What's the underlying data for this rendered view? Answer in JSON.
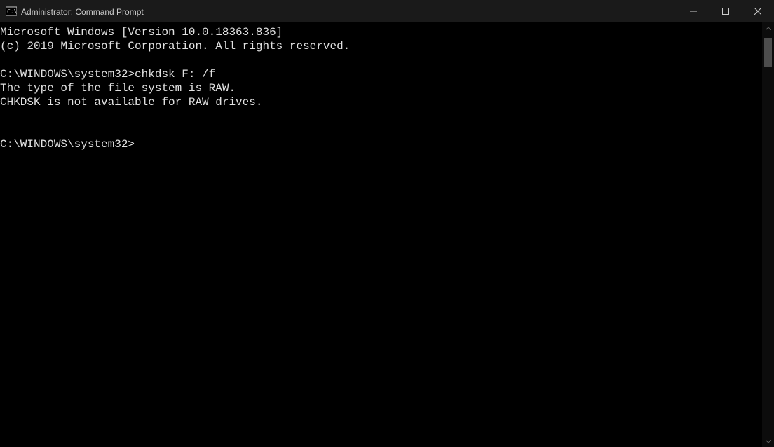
{
  "window": {
    "title": "Administrator: Command Prompt"
  },
  "terminal": {
    "lines": [
      "Microsoft Windows [Version 10.0.18363.836]",
      "(c) 2019 Microsoft Corporation. All rights reserved.",
      "",
      "C:\\WINDOWS\\system32>chkdsk F: /f",
      "The type of the file system is RAW.",
      "CHKDSK is not available for RAW drives.",
      "",
      "",
      "C:\\WINDOWS\\system32>"
    ],
    "prompt": "C:\\WINDOWS\\system32>",
    "last_command": "chkdsk F: /f"
  },
  "colors": {
    "background": "#000000",
    "foreground": "#e0e0e0",
    "titlebar": "#1a1a1a"
  }
}
